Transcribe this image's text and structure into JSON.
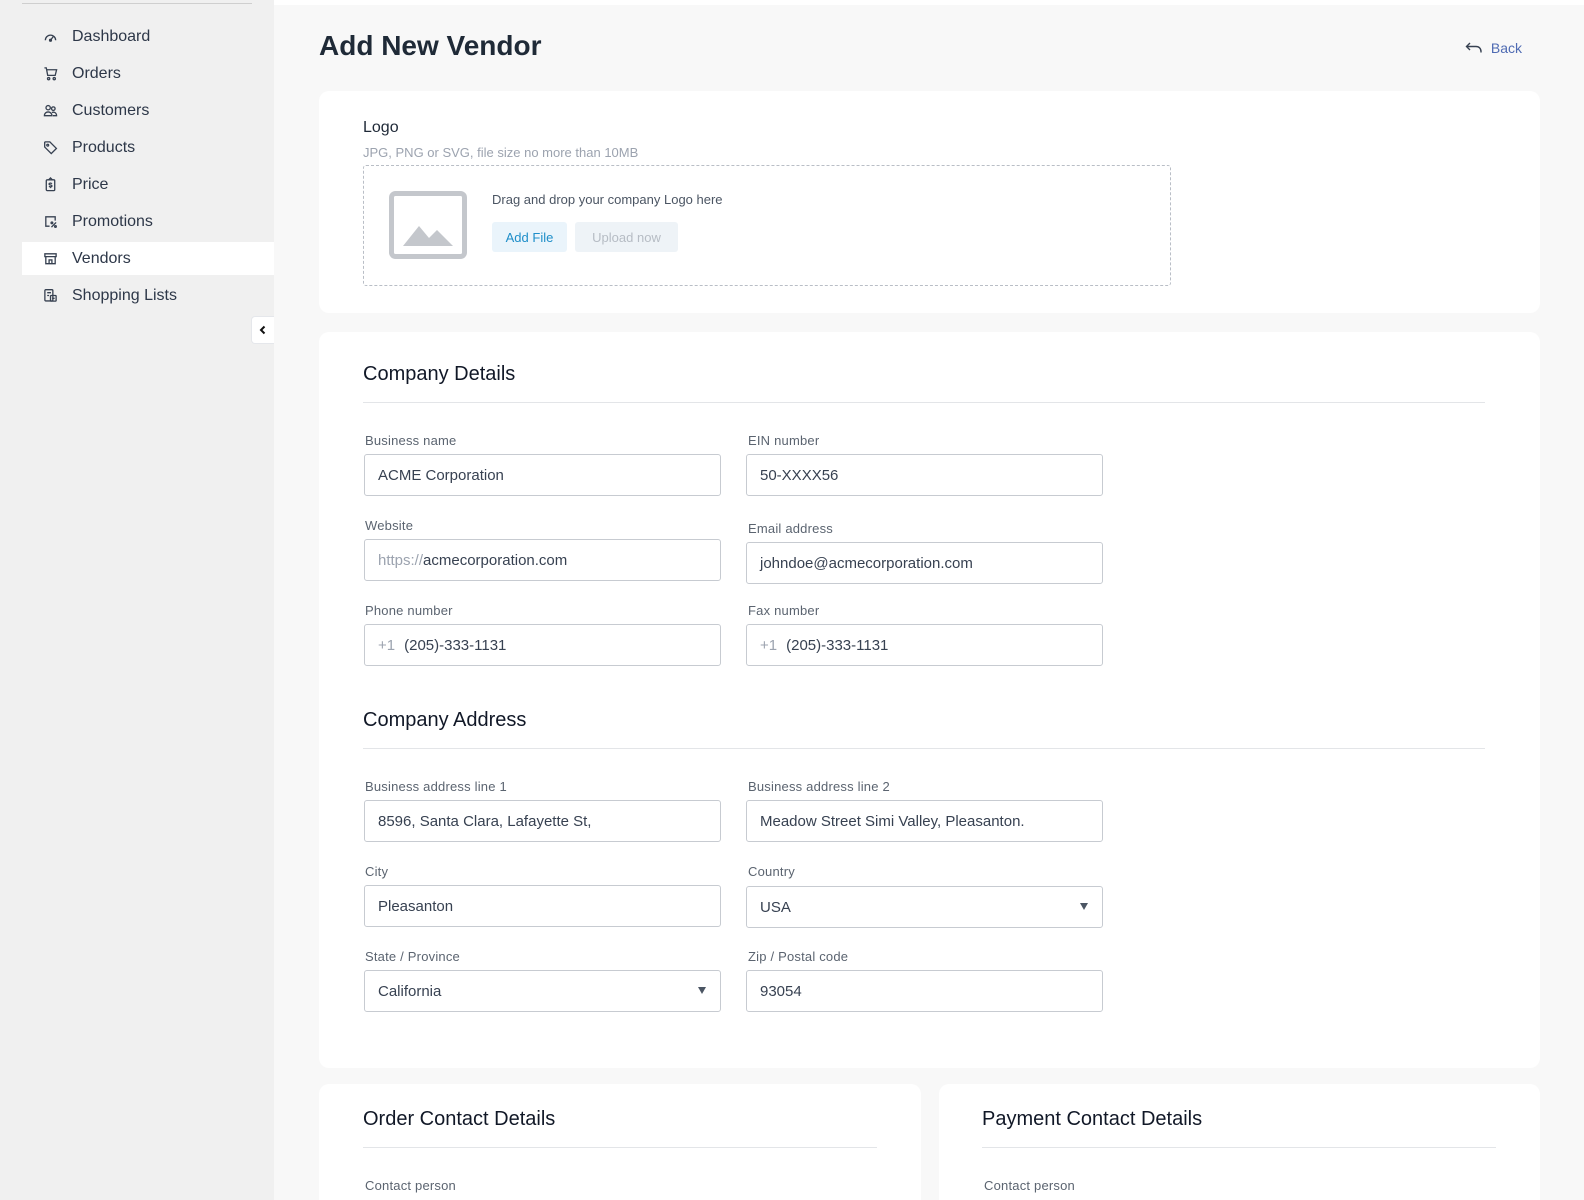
{
  "sidebar": {
    "items": [
      {
        "label": "Dashboard",
        "icon": "dashboard-gauge-icon"
      },
      {
        "label": "Orders",
        "icon": "cart-icon"
      },
      {
        "label": "Customers",
        "icon": "users-icon"
      },
      {
        "label": "Products",
        "icon": "tag-icon"
      },
      {
        "label": "Price",
        "icon": "price-tag-icon"
      },
      {
        "label": "Promotions",
        "icon": "percent-icon"
      },
      {
        "label": "Vendors",
        "icon": "store-icon",
        "active": true
      },
      {
        "label": "Shopping Lists",
        "icon": "list-icon"
      }
    ]
  },
  "header": {
    "title": "Add New Vendor",
    "back_label": "Back"
  },
  "logo": {
    "title": "Logo",
    "subtitle": "JPG, PNG or SVG, file size no more than 10MB",
    "drop_text": "Drag and drop your company Logo here",
    "add_file_label": "Add File",
    "upload_label": "Upload now"
  },
  "company_details": {
    "title": "Company Details",
    "business_name": {
      "label": "Business name",
      "value": "ACME Corporation"
    },
    "ein": {
      "label": "EIN number",
      "value": "50-XXXX56"
    },
    "website": {
      "label": "Website",
      "prefix": "https://",
      "value": "acmecorporation.com"
    },
    "email": {
      "label": "Email address",
      "value": "johndoe@acmecorporation.com"
    },
    "phone": {
      "label": "Phone number",
      "prefix": "+1",
      "value": "(205)-333-1131"
    },
    "fax": {
      "label": "Fax number",
      "prefix": "+1",
      "value": "(205)-333-1131"
    }
  },
  "company_address": {
    "title": "Company Address",
    "line1": {
      "label": "Business address line 1",
      "value": "8596, Santa Clara, Lafayette St,"
    },
    "line2": {
      "label": "Business address line 2",
      "value": "Meadow Street Simi Valley, Pleasanton."
    },
    "city": {
      "label": "City",
      "value": "Pleasanton"
    },
    "country": {
      "label": "Country",
      "value": "USA"
    },
    "state": {
      "label": "State / Province",
      "value": "California"
    },
    "zip": {
      "label": "Zip / Postal code",
      "value": "93054"
    }
  },
  "order_contact": {
    "title": "Order Contact Details",
    "contact_label": "Contact person"
  },
  "payment_contact": {
    "title": "Payment Contact Details",
    "contact_label": "Contact person"
  },
  "colors": {
    "accent": "#1e8ec9",
    "link": "#4f6bb3",
    "sidebar_bg": "#f0f0f0",
    "page_bg": "#f8f8f8"
  }
}
